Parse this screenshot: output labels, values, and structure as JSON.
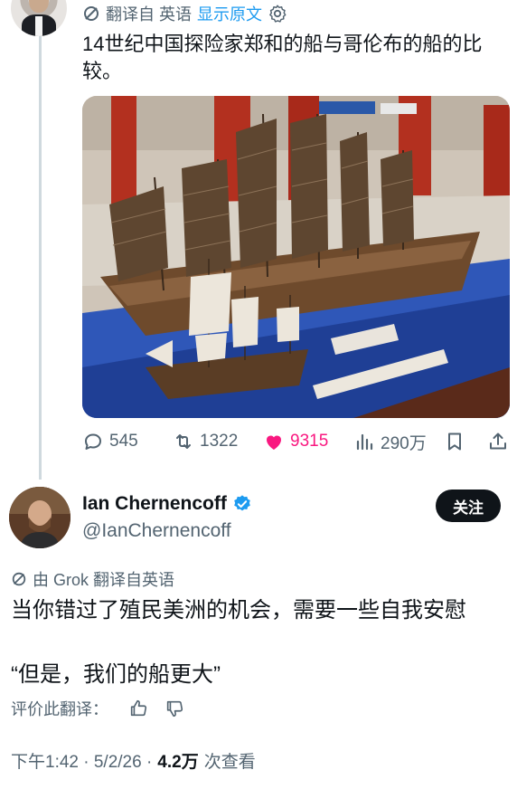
{
  "parent_tweet": {
    "translation_label": "翻译自 英语",
    "show_original_label": "显示原文",
    "text": "14世纪中国探险家郑和的船与哥伦布的船的比较。",
    "stats": {
      "replies": "545",
      "reposts": "1322",
      "likes": "9315",
      "views": "290万"
    }
  },
  "reply_tweet": {
    "display_name": "Ian Chernencoff",
    "handle": "@IanChernencoff",
    "follow_label": "关注",
    "translation_label": "由 Grok 翻译自英语",
    "text_line1": "当你错过了殖民美洲的机会，需要一些自我安慰",
    "text_line2": "“但是，我们的船更大”",
    "rate_label": "评价此翻译：",
    "timestamp": "下午1:42 · 5/2/26 ·",
    "views_count": "4.2万",
    "views_label": "次查看"
  },
  "colors": {
    "accent": "#1d9bf0",
    "like": "#f91880",
    "secondary_text": "#536471",
    "primary_text": "#0f1419"
  },
  "icons": [
    "no-translate-icon",
    "gear-icon",
    "reply-icon",
    "repost-icon",
    "heart-icon",
    "views-chart-icon",
    "bookmark-icon",
    "share-icon",
    "verified-badge-icon",
    "thumbs-up-icon",
    "thumbs-down-icon"
  ]
}
